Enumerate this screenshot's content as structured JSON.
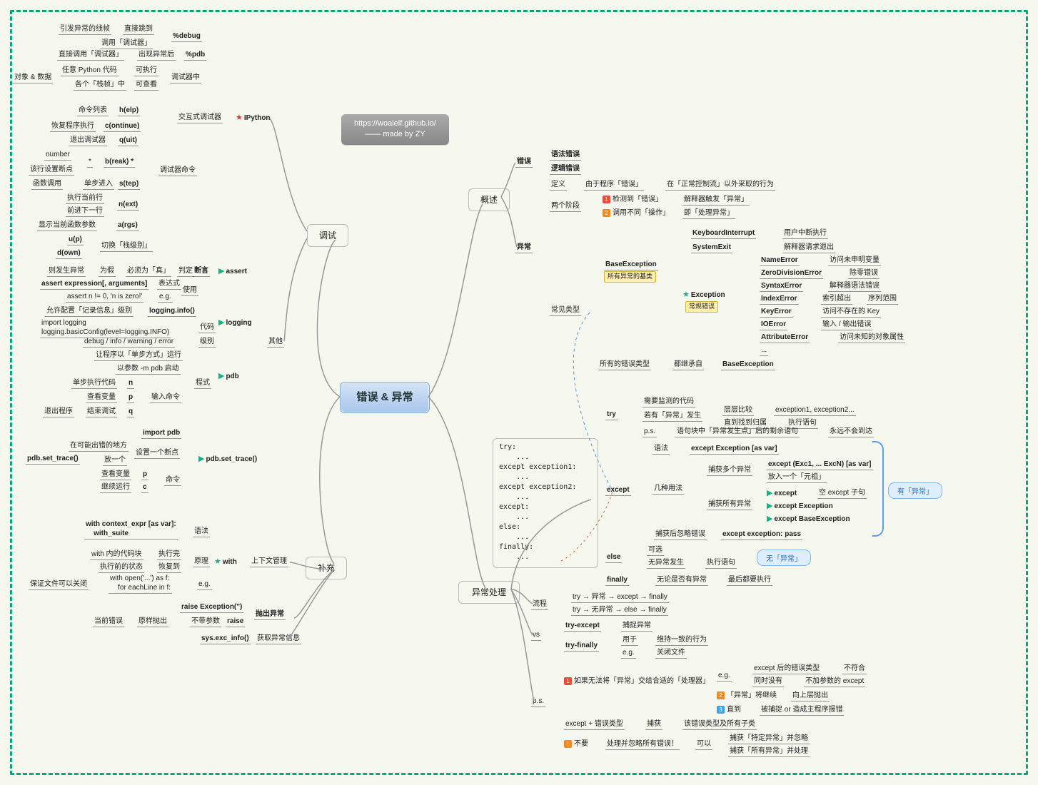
{
  "meta": {
    "watermark_url": "https://woaielf.github.io/",
    "watermark_by": "—— made by ZY"
  },
  "root": "错误 & 异常",
  "branches": {
    "l_debug": "调试",
    "l_supp": "补充",
    "r_over": "概述",
    "r_exch": "异常处理"
  },
  "debug": {
    "ipython": {
      "name": "IPython",
      "sub": "交互式调试器"
    },
    "ipy": {
      "mdebug": "%debug",
      "mdebug_a": "引发异常的线帧",
      "mdebug_b": "直接跳到",
      "mdebug_c": "调用「调试器」",
      "mpdb": "%pdb",
      "mpdb_a": "直接调用「调试器」",
      "mpdb_b": "出现异常后",
      "dbgctx": "调试器中",
      "dbg_a": "任意 Python 代码",
      "dbg_b": "可执行",
      "dbg_c": "各个「栈帧」中",
      "dbg_d": "可查看",
      "dbg_e": "对象 & 数据",
      "cmds": "调试器命令",
      "help": "h(elp)",
      "help_a": "命令列表",
      "cont": "c(ontinue)",
      "cont_a": "恢复程序执行",
      "quit": "q(uit)",
      "quit_a": "退出调试器",
      "breakp": "b(reak) *",
      "breakp_s": "*",
      "breakp_n": "number",
      "breakp_a": "该行设置断点",
      "step": "s(tep)",
      "step_a": "单步进入",
      "step_b": "函数调用",
      "next": "n(ext)",
      "next_a": "执行当前行",
      "next_b": "前进下一行",
      "args": "a(rgs)",
      "args_a": "显示当前函数参数",
      "updown": "切换「栈级别」",
      "up": "u(p)",
      "down": "d(own)"
    },
    "other": "其他",
    "assert": {
      "name": "assert",
      "label": "断言",
      "hint": "判定",
      "must": "必须为「真」",
      "else": "为假",
      "thrown": "则发生异常",
      "use": "使用",
      "expr_l": "表达式",
      "expr": "assert expression[, arguments]",
      "eg_l": "e.g.",
      "eg": "assert n != 0, 'n is zero!'"
    },
    "logging": {
      "name": "logging",
      "info": "logging.info()",
      "info_a": "允许配置「记录信息」级别",
      "code_l": "代码",
      "code": "import logging\nlogging.basicConfig(level=logging.INFO)",
      "level_l": "级别",
      "level": "debug / info / warning / error"
    },
    "pdb": {
      "name": "pdb",
      "a": "让程序以「单步方式」运行",
      "b": "以参数 -m pdb 启动",
      "form": "程式",
      "cmd_l": "输入命令",
      "n": "n",
      "n_a": "单步执行代码",
      "p": "p",
      "p_a": "查看变量",
      "q": "q",
      "q_a": "结束调试",
      "q_b": "退出程序"
    },
    "settrace": {
      "name": "pdb.set_trace()",
      "imp": "import pdb",
      "set": "pdb.set_trace()",
      "set_a": "设置一个断点",
      "set_b": "在可能出错的地方",
      "set_c": "放一个",
      "cmd_l": "命令",
      "p": "p",
      "p_a": "查看变量",
      "c": "c",
      "c_a": "继续运行"
    }
  },
  "supp": {
    "ctx": "上下文管理",
    "with": {
      "name": "with",
      "syntax_l": "语法",
      "syntax": "with context_expr [as var]:\n    with_suite",
      "principle": "原理",
      "pa": "执行完",
      "pb": "with 内的代码块",
      "pc": "恢复到",
      "pd": "执行前的状态",
      "eg_l": "e.g.",
      "eg": "with open('...') as f:\n    for eachLine in f:",
      "eg_a": "保证文件可以关闭"
    },
    "raise": {
      "title": "抛出异常",
      "raise": "raise",
      "raise_a": "不带参数",
      "raise_b": "原样抛出",
      "raise_c": "当前错误",
      "raise_ex": "raise Exception('')",
      "sys": "sys.exc_info()",
      "sys_a": "获取异常信息"
    }
  },
  "overview": {
    "err": "错误",
    "err_syntax": "语法错误",
    "err_logic": "逻辑错误",
    "exc": "异常",
    "def": "定义",
    "def_a": "由于程序「错误」",
    "def_b": "在「正常控制流」以外采取的行为",
    "two": "两个阶段",
    "two_a": "检测到「错误」",
    "two_b": "解释器触发「异常」",
    "two_c": "调用不同「操作」",
    "two_d": "即「处理异常」",
    "types": "常见类型",
    "base": "BaseException",
    "base_note": "所有异常的基类",
    "kbi": "KeyboardInterrupt",
    "kbi_a": "用户中断执行",
    "sysexit": "SystemExit",
    "sysexit_a": "解释器请求退出",
    "excp": "Exception",
    "excp_note": "常规错误",
    "name_e": "NameError",
    "name_a": "访问未申明变量",
    "zero_e": "ZeroDivisionError",
    "zero_a": "除零错误",
    "syntax_e": "SyntaxError",
    "syntax_a": "解释器语法错误",
    "index_e": "IndexError",
    "index_a": "索引超出",
    "index_b": "序列范围",
    "key_e": "KeyError",
    "key_a": "访问不存在的 Key",
    "io_e": "IOError",
    "io_a": "输入 / 输出错误",
    "attr_e": "AttributeError",
    "attr_a": "访问未知的对象属性",
    "dots": "...",
    "all": "所有的错误类型",
    "all_a": "都继承自",
    "all_b": "BaseException"
  },
  "handle": {
    "try": "try",
    "try_a": "需要监测的代码",
    "try_b": "若有「异常」发生",
    "try_b1": "层层比较",
    "try_b2": "exception1, exception2...",
    "try_b3": "直到找到归属",
    "try_b4": "执行语句",
    "try_c": "p.s.",
    "try_c1": "语句块中「异常发生点」后的剩余语句",
    "try_c2": "永远不会到达",
    "except": "except",
    "ex_syntax": "语法",
    "ex_syntax_v": "except Exception [as var]",
    "ex_uses": "几种用法",
    "ex_u1_a": "捕获多个异常",
    "ex_u1_b": "except (Exc1, ... ExcN) [as var]",
    "ex_u1_c": "放入一个「元祖」",
    "ex_u2_a": "捕获所有异常",
    "ex_u2_b1": "except",
    "ex_u2_b1a": "空 except 子句",
    "ex_u2_b2": "except Exception",
    "ex_u2_b3": "except BaseException",
    "ex_ignore": "捕获后忽略错误",
    "ex_ignore_v": "except exception: pass",
    "else": "else",
    "else_a": "可选",
    "else_b": "无异常发生",
    "else_c": "执行语句",
    "finally": "finally",
    "finally_a": "无论是否有异常",
    "finally_b": "最后都要执行",
    "code_title": "try:",
    "code": "try:\n    ...\nexcept exception1:\n    ...\nexcept exception2:\n    ...\nexcept:\n    ...\nelse:\n    ...\nfinally:\n    ...",
    "flow": "流程",
    "flow_a": "try → 异常 → except → finally",
    "flow_b": "try → 无异常 → else → finally",
    "vs": "vs",
    "vs_a": "try-except",
    "vs_a1": "捕捉异常",
    "vs_b": "try-finally",
    "vs_b1": "用于",
    "vs_b2": "维持一致的行为",
    "vs_b3": "e.g.",
    "vs_b4": "关闭文件",
    "ps": "p.s.",
    "ps1": "如果无法将「异常」交给合适的「处理器」",
    "ps1_eg": "e.g.",
    "ps1_a": "except 后的错误类型",
    "ps1_b": "不符合",
    "ps1_c": "同时没有",
    "ps1_d": "不加参数的 except",
    "ps1_e": "「异常」将继续",
    "ps1_f": "向上层抛出",
    "ps1_g": "直到",
    "ps1_h": "被捕捉 or 造成主程序报错",
    "ps2_a": "except + 错误类型",
    "ps2_b": "捕获",
    "ps2_c": "该错误类型及所有子类",
    "ps3": "不要",
    "ps3_a": "处理并忽略所有错误！",
    "ps3_b": "可以",
    "ps3_c": "捕获「特定异常」并忽略",
    "ps3_d": "捕获「所有异常」并处理",
    "bubble_has": "有「异常」",
    "bubble_none": "无「异常」"
  }
}
